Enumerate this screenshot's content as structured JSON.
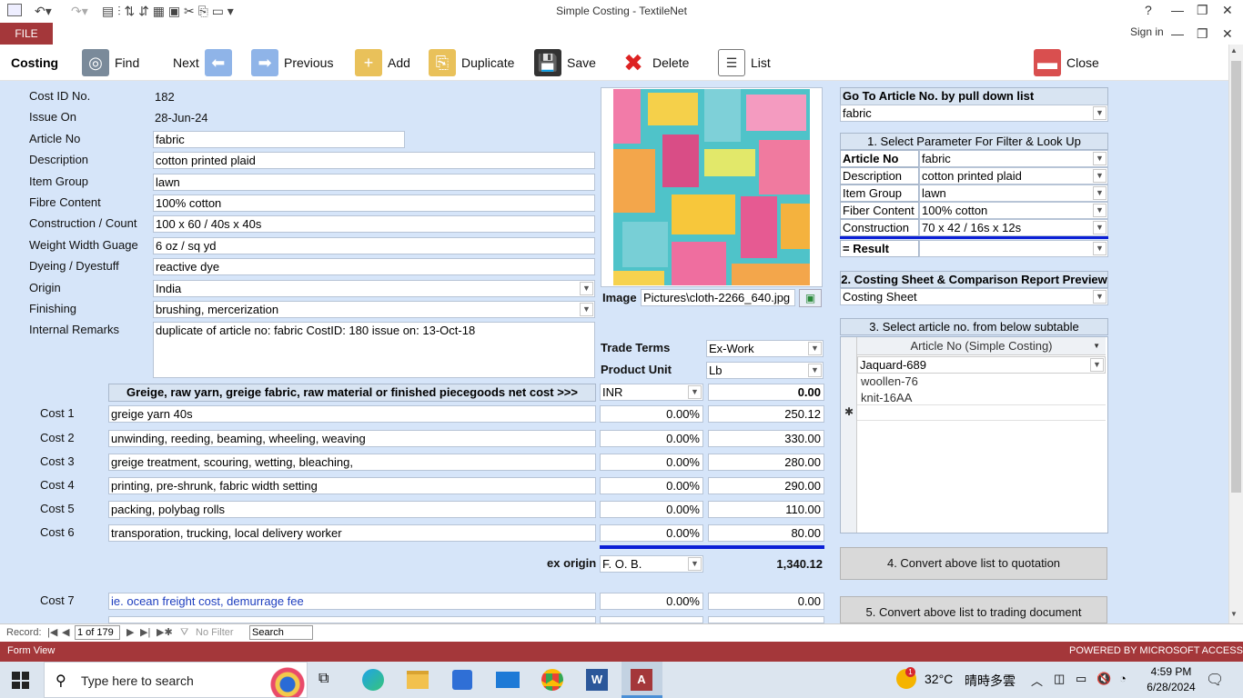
{
  "window": {
    "title": "Simple Costing - TextileNet",
    "help": "?",
    "signin": "Sign in",
    "file_tab": "FILE"
  },
  "toolbar": {
    "costing_label": "Costing",
    "find": "Find",
    "next": "Next",
    "previous": "Previous",
    "add": "Add",
    "duplicate": "Duplicate",
    "save": "Save",
    "delete": "Delete",
    "list": "List",
    "close": "Close"
  },
  "record": {
    "cost_id_label": "Cost ID No.",
    "cost_id": "182",
    "issue_label": "Issue On",
    "issue": "28-Jun-24",
    "article_label": "Article No",
    "article": "fabric",
    "description_label": "Description",
    "description": "cotton printed plaid",
    "item_group_label": "Item Group",
    "item_group": "lawn",
    "fibre_label": "Fibre Content",
    "fibre": "100% cotton",
    "construction_label": "Construction / Count",
    "construction": "100 x 60 / 40s x 40s",
    "weight_label": "Weight Width Guage",
    "weight": "6 oz / sq yd",
    "dyeing_label": "Dyeing / Dyestuff",
    "dyeing": "reactive dye",
    "origin_label": "Origin",
    "origin": "India",
    "finishing_label": "Finishing",
    "finishing": "brushing, mercerization",
    "remarks_label": "Internal Remarks",
    "remarks": "duplicate of article no: fabric CostID: 180  issue on: 13-Oct-18",
    "image_label": "Image",
    "image_path": "Pictures\\cloth-2266_640.jpg",
    "trade_terms_label": "Trade Terms",
    "trade_terms": "Ex-Work",
    "product_unit_label": "Product Unit",
    "product_unit": "Lb"
  },
  "costs": {
    "header": "Greige, raw yarn, greige fabric, raw material or finished piecegoods net cost    >>>",
    "currency": "INR",
    "base_value": "0.00",
    "rows": [
      {
        "label": "Cost 1",
        "desc": "greige yarn 40s",
        "pct": "0.00%",
        "value": "250.12"
      },
      {
        "label": "Cost 2",
        "desc": "unwinding, reeding, beaming, wheeling, weaving",
        "pct": "0.00%",
        "value": "330.00"
      },
      {
        "label": "Cost 3",
        "desc": "greige treatment, scouring, wetting, bleaching,",
        "pct": "0.00%",
        "value": "280.00"
      },
      {
        "label": "Cost 4",
        "desc": "printing, pre-shrunk, fabric width setting",
        "pct": "0.00%",
        "value": "290.00"
      },
      {
        "label": "Cost 5",
        "desc": "packing, polybag rolls",
        "pct": "0.00%",
        "value": "110.00"
      },
      {
        "label": "Cost 6",
        "desc": "transporation, trucking, local delivery worker",
        "pct": "0.00%",
        "value": "80.00"
      }
    ],
    "ex_origin_label": "ex origin",
    "ex_origin_term": "F. O. B.",
    "ex_origin_total": "1,340.12",
    "cost7": {
      "label": "Cost 7",
      "desc": "ie. ocean freight cost, demurrage fee",
      "pct": "0.00%",
      "value": "0.00"
    }
  },
  "right_panel": {
    "goto_header": "Go To Article No. by pull down list",
    "goto_value": "fabric",
    "filter_header": "1. Select Parameter For Filter & Look Up",
    "filters": [
      {
        "label": "Article No",
        "value": "fabric"
      },
      {
        "label": "Description",
        "value": "cotton printed plaid"
      },
      {
        "label": "Item Group",
        "value": "lawn"
      },
      {
        "label": "Fiber Content",
        "value": "100% cotton"
      },
      {
        "label": "Construction",
        "value": "70 x 42 / 16s x 12s"
      }
    ],
    "result_label": "= Result",
    "sheet_header": "2. Costing Sheet & Comparison Report Preview",
    "sheet_value": "Costing Sheet",
    "subtable_header": "3. Select article no.  from below subtable",
    "subtable_col": "Article No (Simple Costing)",
    "subtable_rows": [
      "Jaquard-689",
      "woollen-76",
      "knit-16AA"
    ],
    "btn_quotation": "4. Convert above list to quotation",
    "btn_trading": "5. Convert above list to trading document"
  },
  "recordnav": {
    "label": "Record:",
    "position": "1 of 179",
    "filter": "No Filter",
    "search": "Search"
  },
  "status": {
    "left": "Form View",
    "right": "POWERED BY MICROSOFT ACCESS"
  },
  "taskbar": {
    "search_placeholder": "Type here to search",
    "temp": "32°C",
    "weather": "晴時多雲",
    "time": "4:59 PM",
    "date": "6/28/2024",
    "notif_count": "1"
  },
  "colors": {
    "accent": "#a4373a",
    "form_bg": "#d6e5f9",
    "blue_line": "#0b1fd6"
  }
}
